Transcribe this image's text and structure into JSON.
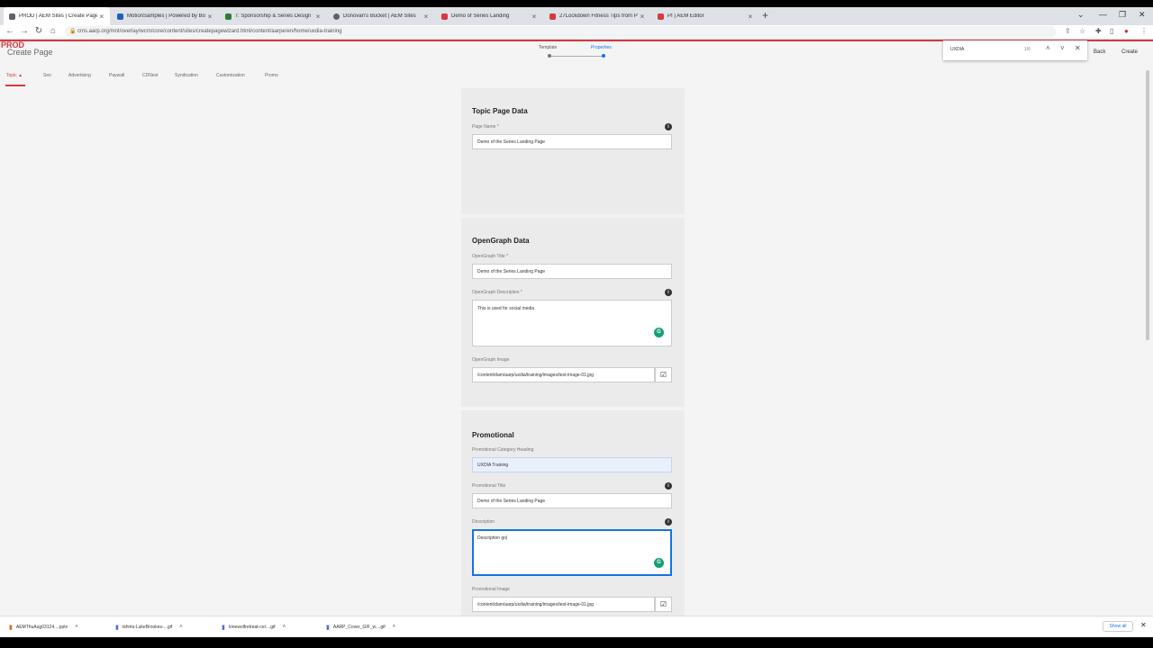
{
  "browser": {
    "tabs": [
      {
        "label": "PROD | AEM Sites | Create Page",
        "color": "#5f6368",
        "active": true
      },
      {
        "label": "MotionSamples | Powered by Bo",
        "color": "#1e5fbf"
      },
      {
        "label": "T: Sponsorship & Series Design",
        "color": "#2e7d32"
      },
      {
        "label": "Donovan's Bucket | AEM Sites",
        "color": "#5f6368"
      },
      {
        "label": "Demo of Series Landing",
        "color": "#d7373f"
      },
      {
        "label": "27Lockdown Fitness Tips from P",
        "color": "#d7373f"
      },
      {
        "label": "PI | AEM Editor",
        "color": "#d7373f"
      }
    ],
    "url": "cms.aarp.org/mnt/overlay/wcm/core/content/sites/createpagewizard.html/content/aarpe/en/home/uxdia-training"
  },
  "find": {
    "query": "UXDIA",
    "count": "1/6"
  },
  "page": {
    "env_label": "PROD",
    "title": "Create Page",
    "steps": [
      "Template",
      "Properties"
    ],
    "back_label": "Back",
    "create_label": "Create",
    "tabs": [
      "Topic",
      "Seo",
      "Advertising",
      "Paywall",
      "CDNext",
      "Syndication",
      "Customization",
      "Promo"
    ]
  },
  "form": {
    "topic": {
      "title": "Topic Page Data",
      "page_name_label": "Page Name *",
      "page_name_value": "Demo of the Series Landing Page"
    },
    "opengraph": {
      "title": "OpenGraph Data",
      "og_title_label": "OpenGraph Title *",
      "og_title_value": "Demo of the Series Landing Page",
      "og_desc_label": "OpenGraph Description *",
      "og_desc_value": "This is used for social media",
      "og_image_label": "OpenGraph Image",
      "og_image_value": "/content/dam/aarp/uxdia/training/images/test-image-01.jpg"
    },
    "promotional": {
      "title": "Promotional",
      "category_label": "Promotional Category Heading",
      "category_value": "UXDIA Training",
      "promo_title_label": "Promotional Title",
      "promo_title_value": "Demo of the Series Landing Page",
      "description_label": "Description",
      "description_value": "Description go|",
      "promo_image_label": "Promotional Image",
      "promo_image_value": "/content/dam/aarp/uxdia/training/images/test-image-01.jpg"
    }
  },
  "downloads": {
    "items": [
      "AEMThuAug03124....pptx",
      "tshirts-LukeBrookes-...gif",
      "lonewolfretreat-cel....gif",
      "AARP_Cover_GIF_w....gif"
    ],
    "show_all": "Show all"
  }
}
